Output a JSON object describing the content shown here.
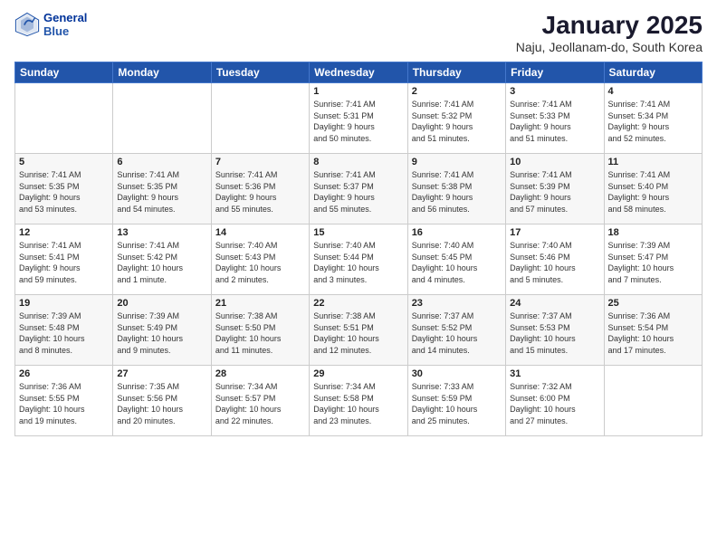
{
  "header": {
    "logo_line1": "General",
    "logo_line2": "Blue",
    "month": "January 2025",
    "location": "Naju, Jeollanam-do, South Korea"
  },
  "days_of_week": [
    "Sunday",
    "Monday",
    "Tuesday",
    "Wednesday",
    "Thursday",
    "Friday",
    "Saturday"
  ],
  "weeks": [
    [
      {
        "day": "",
        "info": ""
      },
      {
        "day": "",
        "info": ""
      },
      {
        "day": "",
        "info": ""
      },
      {
        "day": "1",
        "info": "Sunrise: 7:41 AM\nSunset: 5:31 PM\nDaylight: 9 hours\nand 50 minutes."
      },
      {
        "day": "2",
        "info": "Sunrise: 7:41 AM\nSunset: 5:32 PM\nDaylight: 9 hours\nand 51 minutes."
      },
      {
        "day": "3",
        "info": "Sunrise: 7:41 AM\nSunset: 5:33 PM\nDaylight: 9 hours\nand 51 minutes."
      },
      {
        "day": "4",
        "info": "Sunrise: 7:41 AM\nSunset: 5:34 PM\nDaylight: 9 hours\nand 52 minutes."
      }
    ],
    [
      {
        "day": "5",
        "info": "Sunrise: 7:41 AM\nSunset: 5:35 PM\nDaylight: 9 hours\nand 53 minutes."
      },
      {
        "day": "6",
        "info": "Sunrise: 7:41 AM\nSunset: 5:35 PM\nDaylight: 9 hours\nand 54 minutes."
      },
      {
        "day": "7",
        "info": "Sunrise: 7:41 AM\nSunset: 5:36 PM\nDaylight: 9 hours\nand 55 minutes."
      },
      {
        "day": "8",
        "info": "Sunrise: 7:41 AM\nSunset: 5:37 PM\nDaylight: 9 hours\nand 55 minutes."
      },
      {
        "day": "9",
        "info": "Sunrise: 7:41 AM\nSunset: 5:38 PM\nDaylight: 9 hours\nand 56 minutes."
      },
      {
        "day": "10",
        "info": "Sunrise: 7:41 AM\nSunset: 5:39 PM\nDaylight: 9 hours\nand 57 minutes."
      },
      {
        "day": "11",
        "info": "Sunrise: 7:41 AM\nSunset: 5:40 PM\nDaylight: 9 hours\nand 58 minutes."
      }
    ],
    [
      {
        "day": "12",
        "info": "Sunrise: 7:41 AM\nSunset: 5:41 PM\nDaylight: 9 hours\nand 59 minutes."
      },
      {
        "day": "13",
        "info": "Sunrise: 7:41 AM\nSunset: 5:42 PM\nDaylight: 10 hours\nand 1 minute."
      },
      {
        "day": "14",
        "info": "Sunrise: 7:40 AM\nSunset: 5:43 PM\nDaylight: 10 hours\nand 2 minutes."
      },
      {
        "day": "15",
        "info": "Sunrise: 7:40 AM\nSunset: 5:44 PM\nDaylight: 10 hours\nand 3 minutes."
      },
      {
        "day": "16",
        "info": "Sunrise: 7:40 AM\nSunset: 5:45 PM\nDaylight: 10 hours\nand 4 minutes."
      },
      {
        "day": "17",
        "info": "Sunrise: 7:40 AM\nSunset: 5:46 PM\nDaylight: 10 hours\nand 5 minutes."
      },
      {
        "day": "18",
        "info": "Sunrise: 7:39 AM\nSunset: 5:47 PM\nDaylight: 10 hours\nand 7 minutes."
      }
    ],
    [
      {
        "day": "19",
        "info": "Sunrise: 7:39 AM\nSunset: 5:48 PM\nDaylight: 10 hours\nand 8 minutes."
      },
      {
        "day": "20",
        "info": "Sunrise: 7:39 AM\nSunset: 5:49 PM\nDaylight: 10 hours\nand 9 minutes."
      },
      {
        "day": "21",
        "info": "Sunrise: 7:38 AM\nSunset: 5:50 PM\nDaylight: 10 hours\nand 11 minutes."
      },
      {
        "day": "22",
        "info": "Sunrise: 7:38 AM\nSunset: 5:51 PM\nDaylight: 10 hours\nand 12 minutes."
      },
      {
        "day": "23",
        "info": "Sunrise: 7:37 AM\nSunset: 5:52 PM\nDaylight: 10 hours\nand 14 minutes."
      },
      {
        "day": "24",
        "info": "Sunrise: 7:37 AM\nSunset: 5:53 PM\nDaylight: 10 hours\nand 15 minutes."
      },
      {
        "day": "25",
        "info": "Sunrise: 7:36 AM\nSunset: 5:54 PM\nDaylight: 10 hours\nand 17 minutes."
      }
    ],
    [
      {
        "day": "26",
        "info": "Sunrise: 7:36 AM\nSunset: 5:55 PM\nDaylight: 10 hours\nand 19 minutes."
      },
      {
        "day": "27",
        "info": "Sunrise: 7:35 AM\nSunset: 5:56 PM\nDaylight: 10 hours\nand 20 minutes."
      },
      {
        "day": "28",
        "info": "Sunrise: 7:34 AM\nSunset: 5:57 PM\nDaylight: 10 hours\nand 22 minutes."
      },
      {
        "day": "29",
        "info": "Sunrise: 7:34 AM\nSunset: 5:58 PM\nDaylight: 10 hours\nand 23 minutes."
      },
      {
        "day": "30",
        "info": "Sunrise: 7:33 AM\nSunset: 5:59 PM\nDaylight: 10 hours\nand 25 minutes."
      },
      {
        "day": "31",
        "info": "Sunrise: 7:32 AM\nSunset: 6:00 PM\nDaylight: 10 hours\nand 27 minutes."
      },
      {
        "day": "",
        "info": ""
      }
    ]
  ]
}
